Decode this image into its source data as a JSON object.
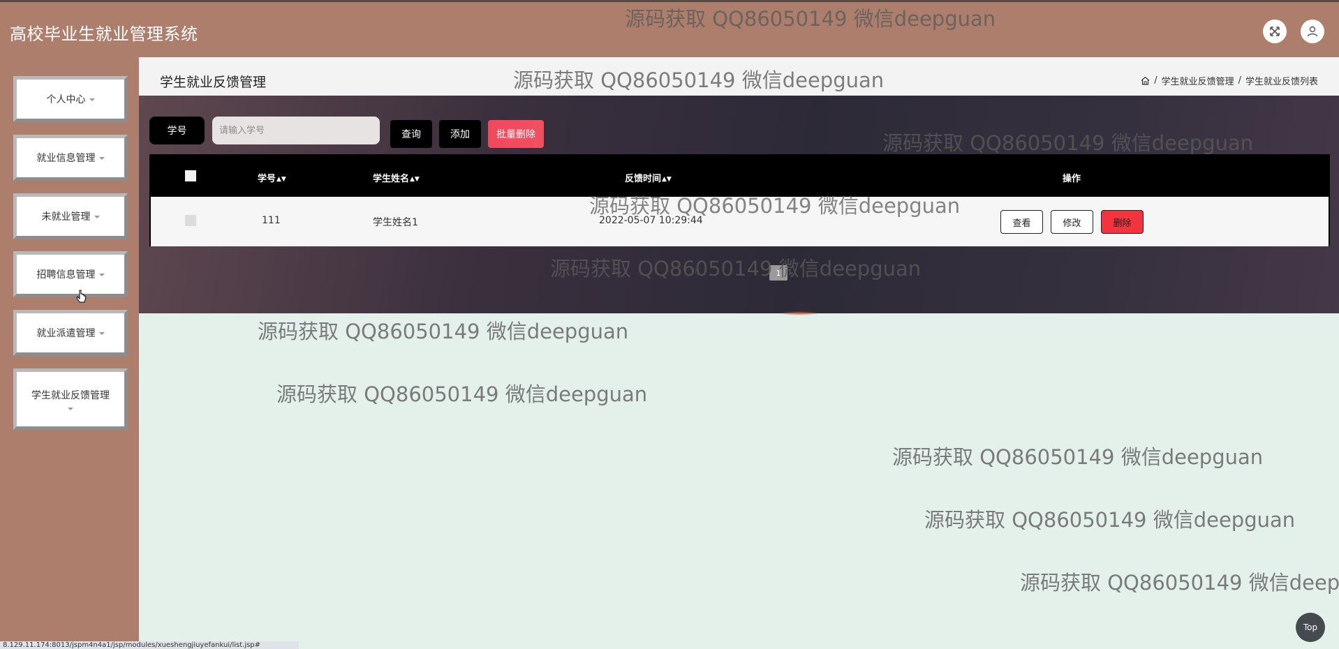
{
  "header": {
    "title": "高校毕业生就业管理系统",
    "icons": [
      "fullscreen-icon",
      "user-icon"
    ]
  },
  "sidebar": {
    "items": [
      {
        "label": "个人中心"
      },
      {
        "label": "就业信息管理"
      },
      {
        "label": "未就业管理"
      },
      {
        "label": "招聘信息管理"
      },
      {
        "label": "就业派遣管理"
      },
      {
        "label": "学生就业反馈管理"
      }
    ]
  },
  "page": {
    "title": "学生就业反馈管理",
    "breadcrumb": [
      "学生就业反馈管理",
      "学生就业反馈列表"
    ]
  },
  "toolbar": {
    "search_label": "学号",
    "search_placeholder": "请输入学号",
    "query_label": "查询",
    "add_label": "添加",
    "bulk_delete_label": "批量删除"
  },
  "table": {
    "headers": {
      "student_id": "学号",
      "student_name": "学生姓名",
      "feedback_time": "反馈时间",
      "actions": "操作"
    },
    "rows": [
      {
        "student_id": "111",
        "student_name": "学生姓名1",
        "feedback_time": "2022-05-07 10:29:44",
        "view_label": "查看",
        "edit_label": "修改",
        "delete_label": "删除"
      }
    ]
  },
  "pagination": {
    "page_size": "10",
    "current_page": "1"
  },
  "watermark": {
    "text": "源码获取 QQ86050149 微信deepguan"
  },
  "status_url": "8.129.11.174:8013/jspm4n4a1/jsp/modules/xueshengjiuyefankui/list.jsp#",
  "top_button_label": "Top",
  "colors": {
    "header_bg": "#ad7e6c",
    "content_bg": "#e4f1eb",
    "danger": "#f1343e",
    "primary": "#000000"
  }
}
